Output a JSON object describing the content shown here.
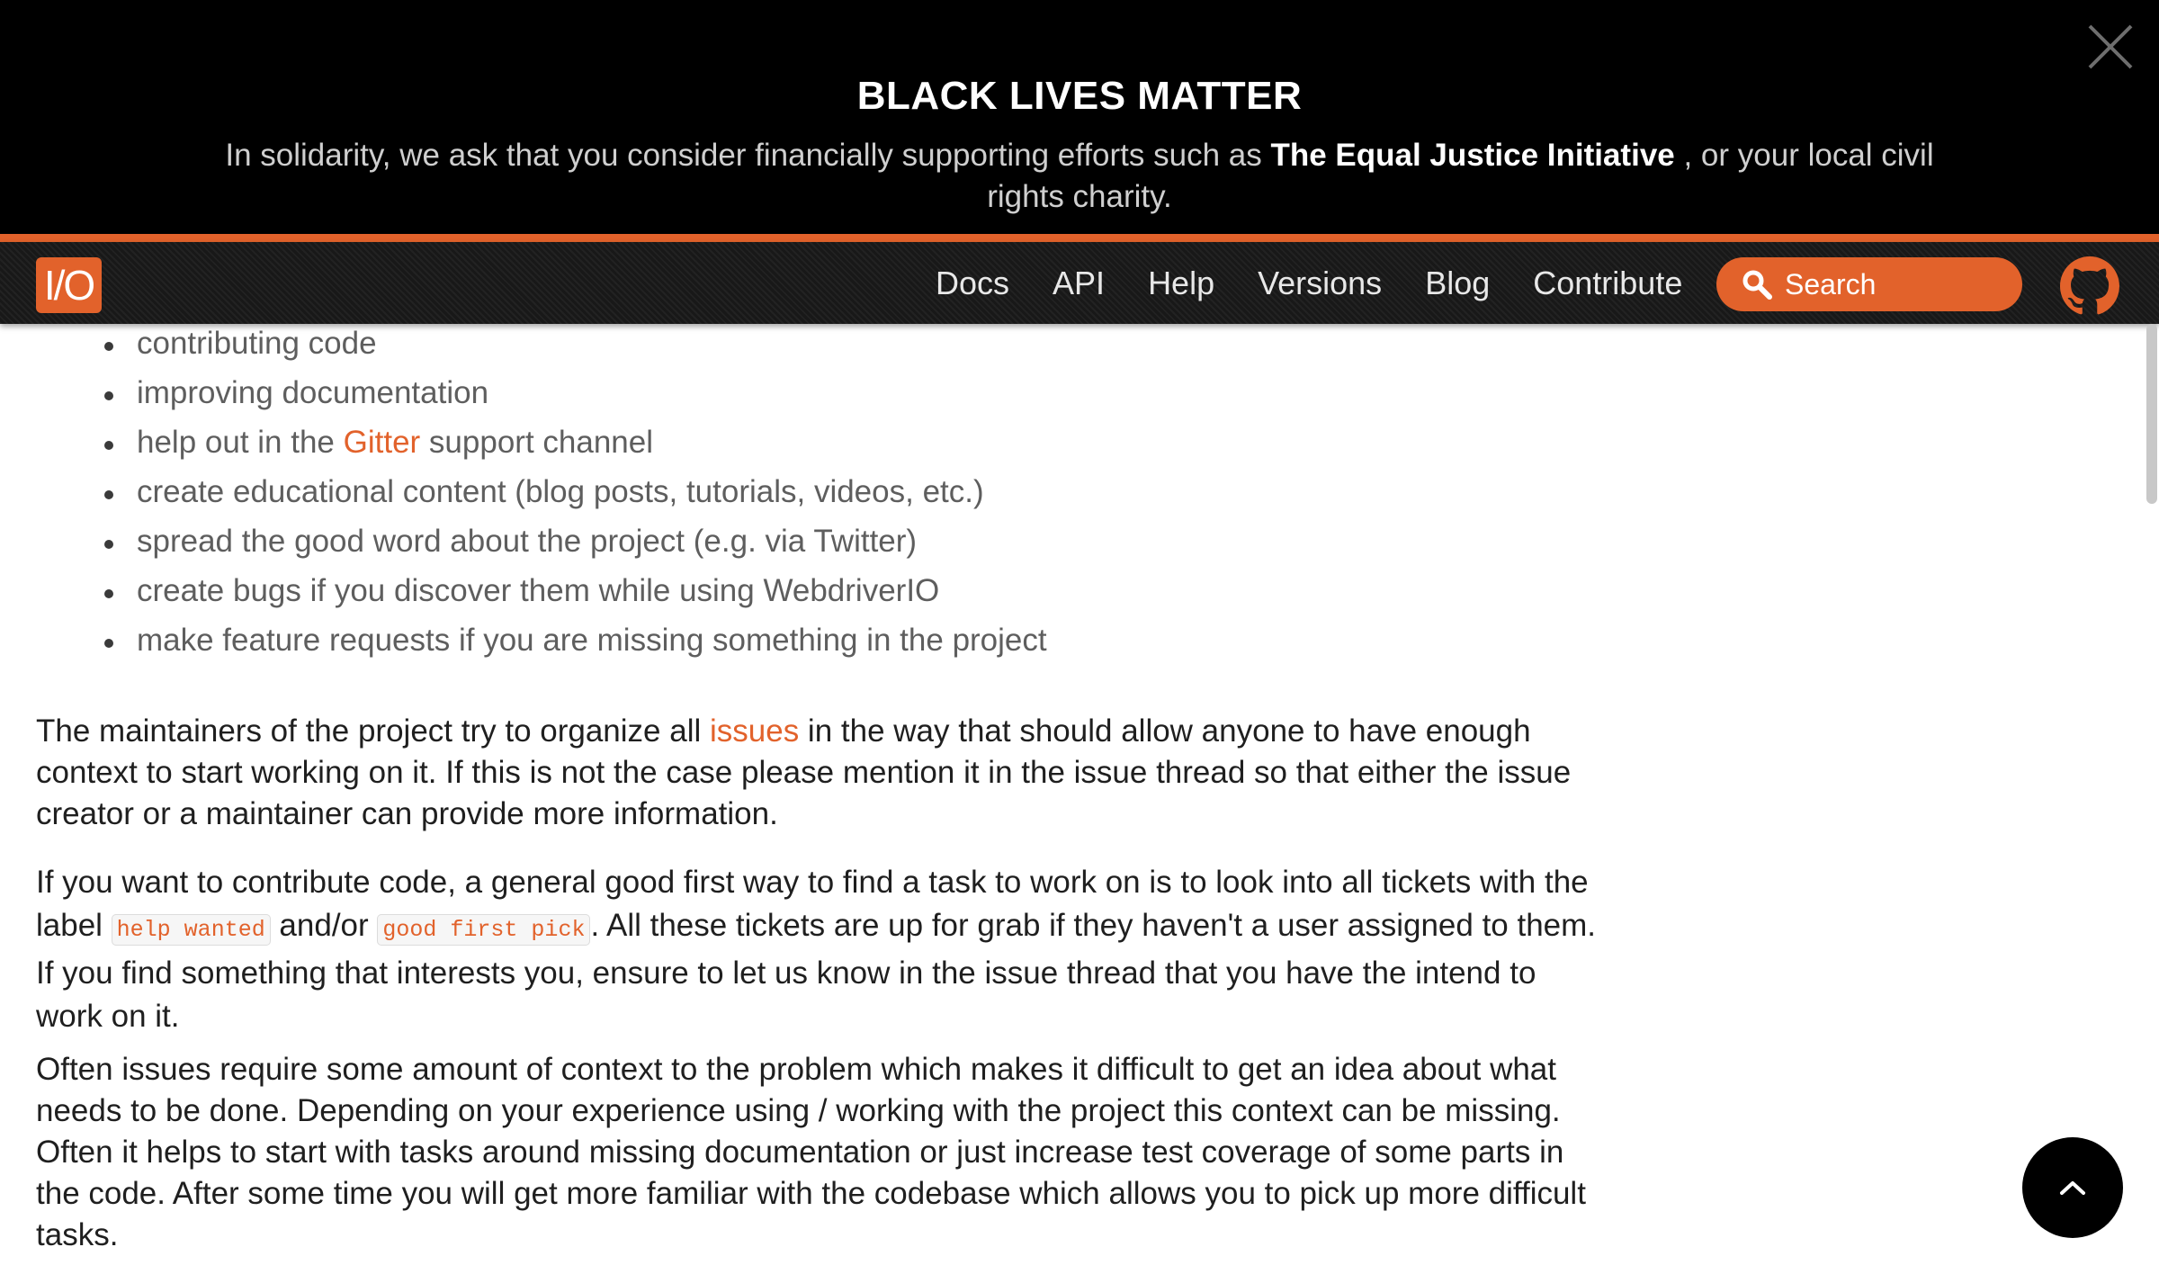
{
  "banner": {
    "title": "BLACK LIVES MATTER",
    "text_before": "In solidarity, we ask that you consider financially supporting efforts such as ",
    "link": "The Equal Justice Initiative",
    "text_after": " , or your local civil rights charity.",
    "close_icon": "close-icon"
  },
  "nav": {
    "logo": "I/O",
    "links": [
      "Docs",
      "API",
      "Help",
      "Versions",
      "Blog",
      "Contribute"
    ],
    "search_placeholder": "Search",
    "search_icon": "search-icon",
    "github_icon": "github-icon"
  },
  "content": {
    "list": [
      {
        "text": "contributing code"
      },
      {
        "text": "improving documentation"
      },
      {
        "pre": "help out in the ",
        "link": "Gitter",
        "post": " support channel"
      },
      {
        "text": "create educational content (blog posts, tutorials, videos, etc.)"
      },
      {
        "text": "spread the good word about the project (e.g. via Twitter)"
      },
      {
        "text": "create bugs if you discover them while using WebdriverIO"
      },
      {
        "text": "make feature requests if you are missing something in the project"
      }
    ],
    "p1": {
      "pre": "The maintainers of the project try to organize all ",
      "link": "issues",
      "post": " in the way that should allow anyone to have enough context to start working on it. If this is not the case please mention it in the issue thread so that either the issue creator or a maintainer can provide more information."
    },
    "p2": {
      "pre": "If you want to contribute code, a general good first way to find a task to work on is to look into all tickets with the label ",
      "code1": "help wanted",
      "mid": " and/or ",
      "code2": "good first pick",
      "post": ". All these tickets are up for grab if they haven't a user assigned to them. If you find something that interests you, ensure to let us know in the issue thread that you have the intend to work on it."
    },
    "p3": "Often issues require some amount of context to the problem which makes it difficult to get an idea about what needs to be done. Depending on your experience using / working with the project this context can be missing. Often it helps to start with tasks around missing documentation or just increase test coverage of some parts in the code. After some time you will get more familiar with the codebase which allows you to pick up more difficult tasks."
  },
  "back_to_top_icon": "chevron-up-icon",
  "colors": {
    "accent": "#e2622b",
    "banner_bg": "#000000",
    "nav_bg": "#1b1b1b"
  }
}
